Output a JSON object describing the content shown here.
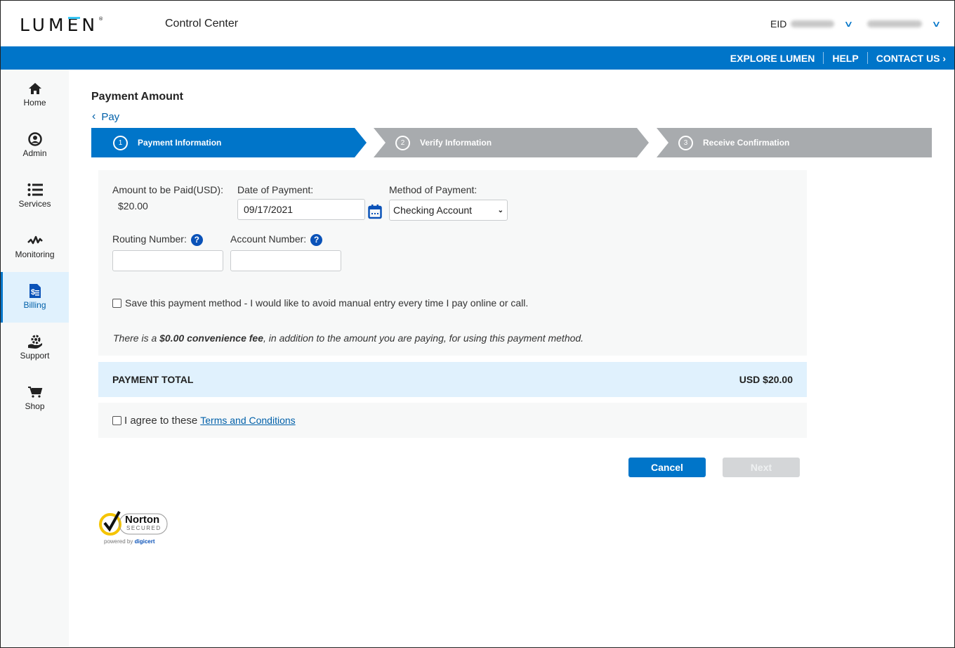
{
  "header": {
    "logo": "LUMEN",
    "app_title": "Control Center",
    "eid_label": "EID",
    "eid_value_redacted": true,
    "user_redacted": true
  },
  "navbar": {
    "links": [
      "EXPLORE LUMEN",
      "HELP",
      "CONTACT US"
    ]
  },
  "sidebar": {
    "items": [
      {
        "label": "Home",
        "icon": "home-icon",
        "active": false
      },
      {
        "label": "Admin",
        "icon": "user-circle-icon",
        "active": false
      },
      {
        "label": "Services",
        "icon": "list-icon",
        "active": false
      },
      {
        "label": "Monitoring",
        "icon": "pulse-icon",
        "active": false
      },
      {
        "label": "Billing",
        "icon": "billing-document-icon",
        "active": true
      },
      {
        "label": "Support",
        "icon": "support-gear-hand-icon",
        "active": false
      },
      {
        "label": "Shop",
        "icon": "cart-icon",
        "active": false
      }
    ]
  },
  "page": {
    "title": "Payment Amount",
    "back_link": "Pay"
  },
  "stepper": {
    "steps": [
      {
        "number": "1",
        "label": "Payment Information",
        "active": true
      },
      {
        "number": "2",
        "label": "Verify Information",
        "active": false
      },
      {
        "number": "3",
        "label": "Receive Confirmation",
        "active": false
      }
    ]
  },
  "form": {
    "amount_label": "Amount to be Paid(USD):",
    "amount_value": "$20.00",
    "date_label": "Date of Payment:",
    "date_value": "09/17/2021",
    "method_label": "Method of Payment:",
    "method_value": "Checking Account",
    "routing_label": "Routing Number:",
    "routing_value": "",
    "account_label": "Account Number:",
    "account_value": "",
    "help_glyph": "?",
    "save_method_label": "Save this payment method - I would like to avoid manual entry every time I pay online or call.",
    "save_method_checked": false,
    "fee_prefix": "There is a ",
    "fee_bold": "$0.00 convenience fee",
    "fee_suffix": ", in addition to the amount you are paying, for using this payment method."
  },
  "total": {
    "label": "PAYMENT TOTAL",
    "value": "USD $20.00"
  },
  "agree": {
    "text": "I agree to these",
    "link": "Terms and Conditions",
    "checked": false
  },
  "buttons": {
    "cancel": "Cancel",
    "next": "Next",
    "next_disabled": true
  },
  "badge": {
    "brand": "Norton",
    "sub": "SECURED",
    "powered": "powered by",
    "powered_brand": "digicert"
  },
  "colors": {
    "brand_blue": "#0075c9",
    "inactive_step": "#a8abae",
    "total_bg": "#e0f1fd",
    "accent_cyan": "#38c6f4"
  }
}
